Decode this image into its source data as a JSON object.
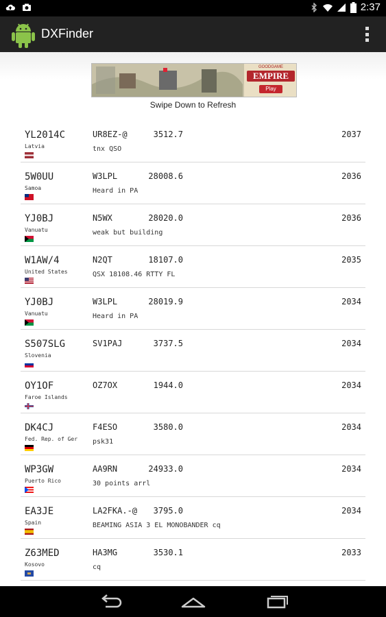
{
  "status_bar": {
    "time": "2:37"
  },
  "action_bar": {
    "title": "DXFinder"
  },
  "ad": {
    "brand": "GOODGAME",
    "game": "EMPIRE",
    "button": "Play"
  },
  "refresh_hint": "Swipe Down to Refresh",
  "spots": [
    {
      "call": "YL2014C",
      "country": "Latvia",
      "spotter": "UR8EZ-@",
      "freq": "3512.7",
      "time": "2037",
      "comment": "tnx QSO",
      "flag": "latvia"
    },
    {
      "call": "5W0UU",
      "country": "Samoa",
      "spotter": "W3LPL",
      "freq": "28008.6",
      "time": "2036",
      "comment": "Heard in PA",
      "flag": "samoa"
    },
    {
      "call": "YJ0BJ",
      "country": "Vanuatu",
      "spotter": "N5WX",
      "freq": "28020.0",
      "time": "2036",
      "comment": "weak but building",
      "flag": "vanuatu"
    },
    {
      "call": "W1AW/4",
      "country": "United States",
      "spotter": "N2QT",
      "freq": "18107.0",
      "time": "2035",
      "comment": "QSX 18108.46 RTTY FL",
      "flag": "usa"
    },
    {
      "call": "YJ0BJ",
      "country": "Vanuatu",
      "spotter": "W3LPL",
      "freq": "28019.9",
      "time": "2034",
      "comment": "Heard in PA",
      "flag": "vanuatu"
    },
    {
      "call": "S507SLG",
      "country": "Slovenia",
      "spotter": "SV1PAJ",
      "freq": "3737.5",
      "time": "2034",
      "comment": "",
      "flag": "slovenia"
    },
    {
      "call": "OY1OF",
      "country": "Faroe Islands",
      "spotter": "OZ7OX",
      "freq": "1944.0",
      "time": "2034",
      "comment": "",
      "flag": "faroe"
    },
    {
      "call": "DK4CJ",
      "country": "Fed. Rep. of Ger",
      "spotter": "F4ESO",
      "freq": "3580.0",
      "time": "2034",
      "comment": "psk31",
      "flag": "germany"
    },
    {
      "call": "WP3GW",
      "country": "Puerto Rico",
      "spotter": "AA9RN",
      "freq": "24933.0",
      "time": "2034",
      "comment": "30 points arrl",
      "flag": "puertorico"
    },
    {
      "call": "EA3JE",
      "country": "Spain",
      "spotter": "LA2FKA.-@",
      "freq": "3795.0",
      "time": "2034",
      "comment": "BEAMING ASIA  3 EL MONOBANDER  cq",
      "flag": "spain"
    },
    {
      "call": "Z63MED",
      "country": "Kosovo",
      "spotter": "HA3MG",
      "freq": "3530.1",
      "time": "2033",
      "comment": "cq",
      "flag": "kosovo"
    }
  ]
}
